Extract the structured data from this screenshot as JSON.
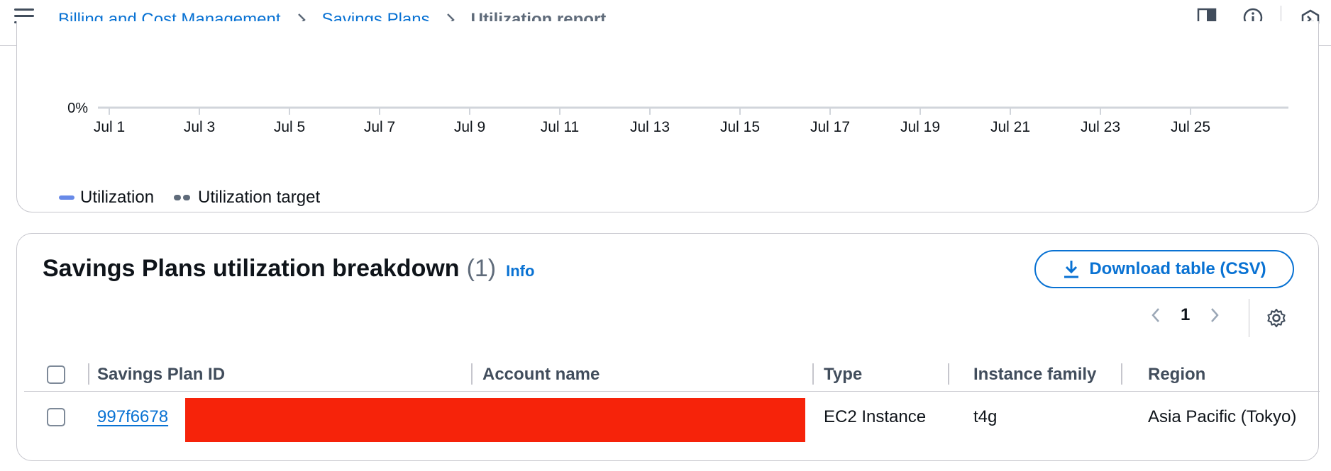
{
  "header": {
    "breadcrumbs": [
      "Billing and Cost Management",
      "Savings Plans"
    ],
    "current_page": "Utilization report",
    "icons": [
      "menu-icon",
      "panel-icon",
      "info-icon",
      "cloudshell-icon"
    ]
  },
  "chart_data": {
    "type": "line",
    "x": [
      "Jul 1",
      "Jul 3",
      "Jul 5",
      "Jul 7",
      "Jul 9",
      "Jul 11",
      "Jul 13",
      "Jul 15",
      "Jul 17",
      "Jul 19",
      "Jul 21",
      "Jul 23",
      "Jul 25"
    ],
    "y_tick_labels": [
      "0%"
    ],
    "series": [
      {
        "name": "Utilization",
        "color": "#688ae8",
        "style": "solid"
      },
      {
        "name": "Utilization target",
        "color": "#5f6b7a",
        "style": "dashed"
      }
    ],
    "legend_position": "bottom-left"
  },
  "breakdown": {
    "title": "Savings Plans utilization breakdown",
    "count": "(1)",
    "info": "Info",
    "download_label": "Download table (CSV)",
    "page": "1",
    "columns": [
      "Savings Plan ID",
      "Account name",
      "Type",
      "Instance family",
      "Region"
    ],
    "rows": [
      {
        "id": "997f6678",
        "account": "",
        "type": "EC2 Instance",
        "family": "t4g",
        "region": "Asia Pacific (Tokyo)"
      }
    ]
  },
  "colors": {
    "link": "#0972d3",
    "utilization_line": "#688ae8",
    "redaction": "#f6230a"
  }
}
